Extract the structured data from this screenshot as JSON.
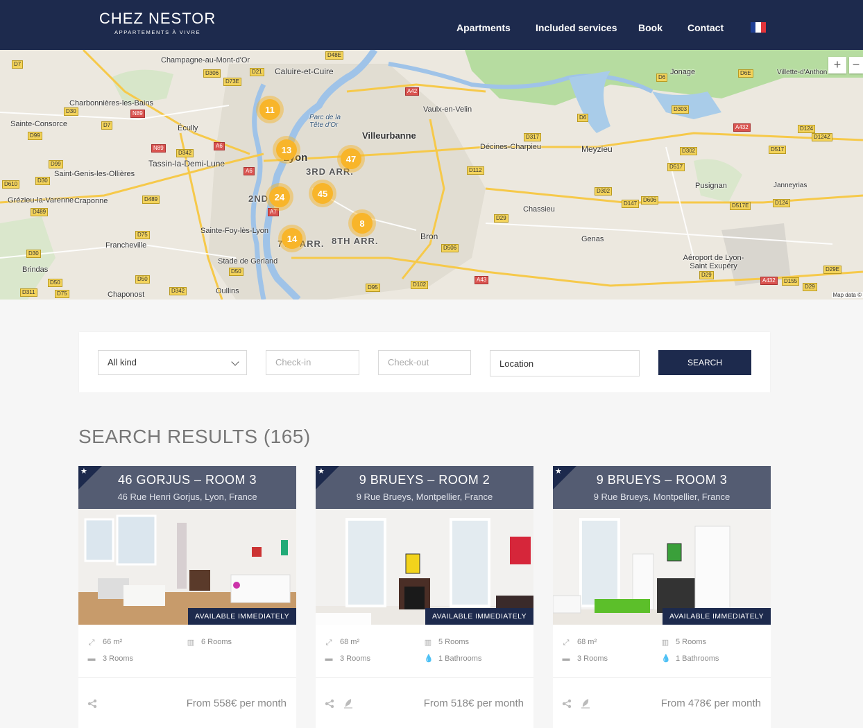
{
  "header": {
    "logo_main": "CHEZ NESTOR",
    "logo_sub": "APPARTEMENTS À VIVRE",
    "nav": [
      "Apartments",
      "Included services",
      "Book",
      "Contact"
    ],
    "language": "French flag",
    "flag_colors": [
      "#1f3f95",
      "#ffffff",
      "#e2343a"
    ]
  },
  "map": {
    "zoom_in": "+",
    "zoom_out": "−",
    "attribution": "Map data ©",
    "places": [
      "Champagne-au-Mont-d'Or",
      "Caluire-et-Cuire",
      "Charbonnières-les-Bains",
      "Sainte-Consorce",
      "Écully",
      "Vaulx-en-Velin",
      "Villeurbanne",
      "Tassin-la-Demi-Lune",
      "Saint-Genis-les-Ollières",
      "Décines-Charpieu",
      "Meyzieu",
      "Jonage",
      "Villette-d'Anthon",
      "Grézieu-la-Varenne",
      "Craponne",
      "Lyon",
      "Sainte-Foy-lès-Lyon",
      "Francheville",
      "Chassieu",
      "Pusignan",
      "Janneyrias",
      "Bron",
      "Genas",
      "Stade de Gerland",
      "Brindas",
      "Oullins",
      "Chaponost",
      "Aéroport de Lyon-Saint Exupéry",
      "Parc de la Tête d'Or",
      "3RD ARR.",
      "2ND",
      "8TH ARR.",
      "7TH ARR."
    ],
    "clusters": [
      "11",
      "13",
      "47",
      "24",
      "45",
      "8",
      "14"
    ]
  },
  "search": {
    "kind": "All kind",
    "checkin_placeholder": "Check-in",
    "checkout_placeholder": "Check-out",
    "location": "Location",
    "button": "SEARCH"
  },
  "results": {
    "title": "SEARCH RESULTS (165)"
  },
  "cards": [
    {
      "title": "46 GORJUS – ROOM 3",
      "address": "46 Rue Henri Gorjus, Lyon, France",
      "badge": "AVAILABLE IMMEDIATELY",
      "area": "66 m²",
      "rooms_total": "6 Rooms",
      "bedrooms": "3 Rooms",
      "bathrooms": "",
      "price": "From 558€ per month",
      "has_leaf": false
    },
    {
      "title": "9 BRUEYS – ROOM 2",
      "address": "9 Rue Brueys, Montpellier, France",
      "badge": "AVAILABLE IMMEDIATELY",
      "area": "68 m²",
      "rooms_total": "5 Rooms",
      "bedrooms": "3 Rooms",
      "bathrooms": "1 Bathrooms",
      "price": "From 518€ per month",
      "has_leaf": true
    },
    {
      "title": "9 BRUEYS – ROOM 3",
      "address": "9 Rue Brueys, Montpellier, France",
      "badge": "AVAILABLE IMMEDIATELY",
      "area": "68 m²",
      "rooms_total": "5 Rooms",
      "bedrooms": "3 Rooms",
      "bathrooms": "1 Bathrooms",
      "price": "From 478€ per month",
      "has_leaf": true
    }
  ]
}
